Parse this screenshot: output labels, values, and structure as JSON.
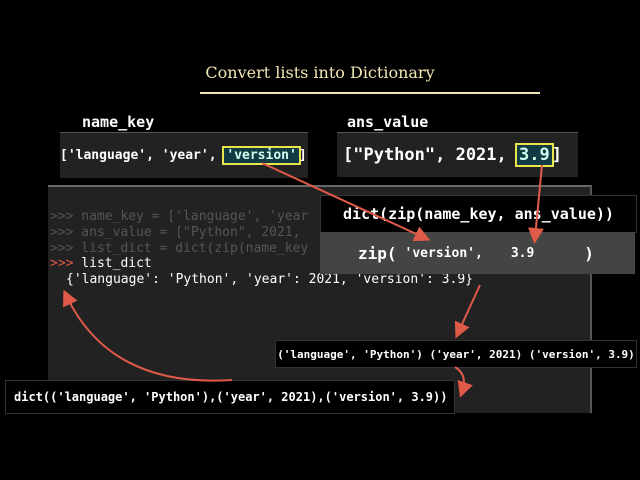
{
  "title": "Convert lists into Dictionary",
  "name_key": {
    "label": "name_key",
    "prefix": "['language', 'year', ",
    "highlight": "'version'",
    "suffix": "]"
  },
  "ans_value": {
    "label": "ans_value",
    "prefix": "[\"Python\", 2021, ",
    "highlight": "3.9",
    "suffix": "]"
  },
  "terminal": {
    "lines": [
      ">>> name_key = ['language', 'year",
      ">>> ans_value = [\"Python\", 2021, ",
      ">>> list_dict = dict(zip(name_key"
    ],
    "prompt": ">>>",
    "command": " list_dict",
    "output": "{'language': 'Python', 'year': 2021, 'version': 3.9}"
  },
  "dict_zip": "dict(zip(name_key, ans_value))",
  "zip_call": {
    "open": "zip(",
    "key": "'version',",
    "value": "3.9",
    "close": ")"
  },
  "tuples": "('language', 'Python') ('year', 2021) ('version', 3.9)",
  "dict_call": "dict(('language', 'Python'),('year', 2021),('version', 3.9))",
  "colors": {
    "arrow": "#e05a4a",
    "highlight_border": "#e6e64a",
    "title": "#f2e7b4"
  }
}
